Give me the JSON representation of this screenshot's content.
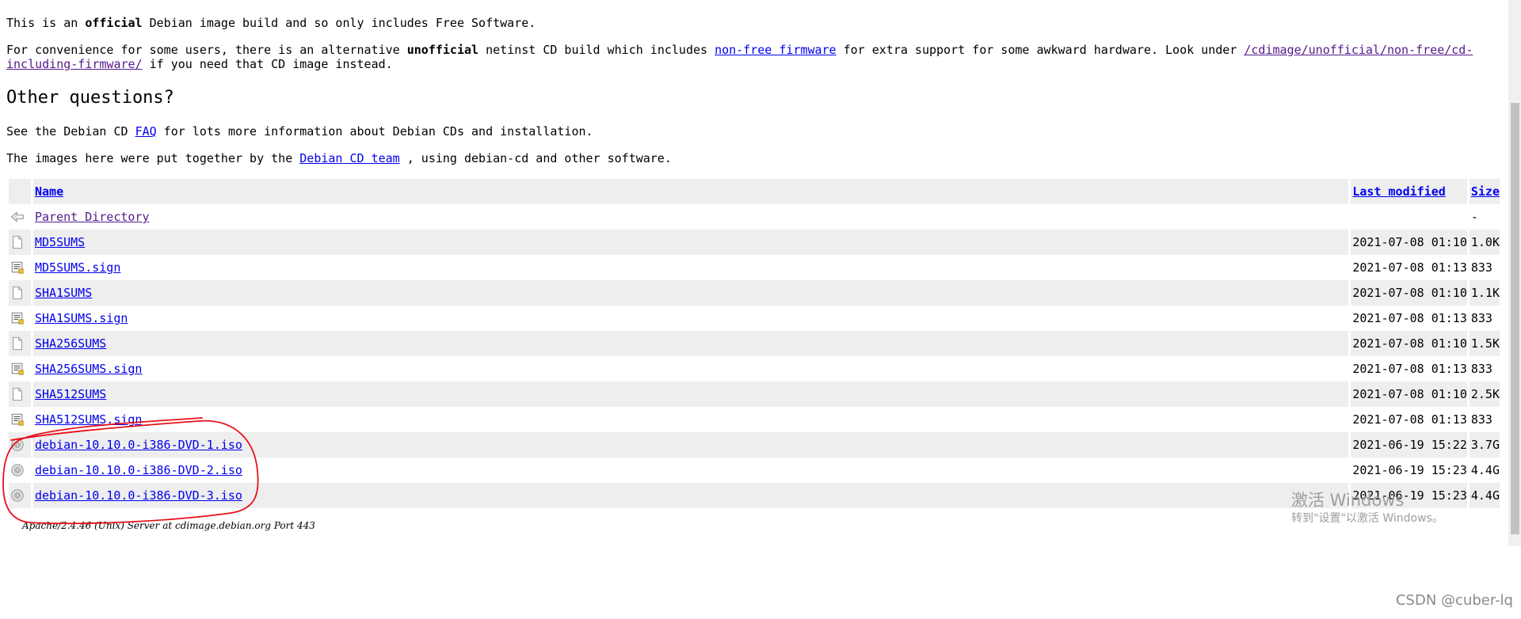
{
  "intro": {
    "p1_pre": "This is an ",
    "p1_bold": "official",
    "p1_post": " Debian image build and so only includes Free Software.",
    "p2_pre": "For convenience for some users, there is an alternative ",
    "p2_bold": "unofficial",
    "p2_mid1": " netinst CD build which includes ",
    "p2_link1": "non-free firmware",
    "p2_mid2": " for extra support for some awkward hardware. Look under ",
    "p2_link2": "/cdimage/unofficial/non-free/cd-including-firmware/",
    "p2_post": " if you need that CD image instead."
  },
  "questions": {
    "heading": "Other questions?",
    "p3_pre": "See the Debian CD ",
    "p3_link": "FAQ",
    "p3_post": " for lots more information about Debian CDs and installation.",
    "p4_pre": "The images here were put together by the ",
    "p4_link": "Debian CD team",
    "p4_post": " , using debian-cd and other software."
  },
  "listing": {
    "headers": {
      "name": "Name",
      "modified": "Last modified",
      "size": "Size"
    },
    "parent": {
      "name": "Parent Directory",
      "size": "-"
    },
    "rows": [
      {
        "name": "MD5SUMS",
        "modified": "2021-07-08 01:10",
        "size": "1.0K",
        "icon": "text-file-icon"
      },
      {
        "name": "MD5SUMS.sign",
        "modified": "2021-07-08 01:13",
        "size": "833",
        "icon": "signature-file-icon"
      },
      {
        "name": "SHA1SUMS",
        "modified": "2021-07-08 01:10",
        "size": "1.1K",
        "icon": "text-file-icon"
      },
      {
        "name": "SHA1SUMS.sign",
        "modified": "2021-07-08 01:13",
        "size": "833",
        "icon": "signature-file-icon"
      },
      {
        "name": "SHA256SUMS",
        "modified": "2021-07-08 01:10",
        "size": "1.5K",
        "icon": "text-file-icon"
      },
      {
        "name": "SHA256SUMS.sign",
        "modified": "2021-07-08 01:13",
        "size": "833",
        "icon": "signature-file-icon"
      },
      {
        "name": "SHA512SUMS",
        "modified": "2021-07-08 01:10",
        "size": "2.5K",
        "icon": "text-file-icon"
      },
      {
        "name": "SHA512SUMS.sign",
        "modified": "2021-07-08 01:13",
        "size": "833",
        "icon": "signature-file-icon"
      },
      {
        "name": "debian-10.10.0-i386-DVD-1.iso",
        "modified": "2021-06-19 15:22",
        "size": "3.7G",
        "icon": "disc-image-icon"
      },
      {
        "name": "debian-10.10.0-i386-DVD-2.iso",
        "modified": "2021-06-19 15:23",
        "size": "4.4G",
        "icon": "disc-image-icon"
      },
      {
        "name": "debian-10.10.0-i386-DVD-3.iso",
        "modified": "2021-06-19 15:23",
        "size": "4.4G",
        "icon": "disc-image-icon"
      }
    ]
  },
  "footer": {
    "address": "Apache/2.4.46 (Unix) Server at cdimage.debian.org Port 443"
  },
  "watermark": {
    "line1": "激活 Windows",
    "line2": "转到\"设置\"以激活 Windows。"
  },
  "csdn": "CSDN @cuber-lq",
  "colors": {
    "link": "#0000ee",
    "visited": "#551a8b",
    "row_alt": "#eeeeee",
    "annotation": "#e8101a"
  }
}
